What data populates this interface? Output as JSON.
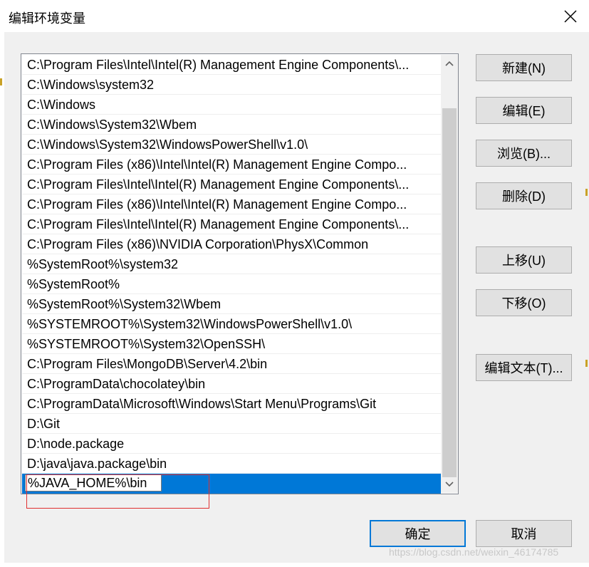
{
  "window": {
    "title": "编辑环境变量",
    "close_icon": "close-icon"
  },
  "list": {
    "items": [
      "C:\\Program Files\\Intel\\Intel(R) Management Engine Components\\...",
      "C:\\Windows\\system32",
      "C:\\Windows",
      "C:\\Windows\\System32\\Wbem",
      "C:\\Windows\\System32\\WindowsPowerShell\\v1.0\\",
      "C:\\Program Files (x86)\\Intel\\Intel(R) Management Engine Compo...",
      "C:\\Program Files\\Intel\\Intel(R) Management Engine Components\\...",
      "C:\\Program Files (x86)\\Intel\\Intel(R) Management Engine Compo...",
      "C:\\Program Files\\Intel\\Intel(R) Management Engine Components\\...",
      "C:\\Program Files (x86)\\NVIDIA Corporation\\PhysX\\Common",
      "%SystemRoot%\\system32",
      "%SystemRoot%",
      "%SystemRoot%\\System32\\Wbem",
      "%SYSTEMROOT%\\System32\\WindowsPowerShell\\v1.0\\",
      "%SYSTEMROOT%\\System32\\OpenSSH\\",
      "C:\\Program Files\\MongoDB\\Server\\4.2\\bin",
      "C:\\ProgramData\\chocolatey\\bin",
      "C:\\ProgramData\\Microsoft\\Windows\\Start Menu\\Programs\\Git",
      "D:\\Git",
      "D:\\node.package",
      "D:\\java\\java.package\\bin"
    ],
    "editing_value": "%JAVA_HOME%\\bin",
    "selection_color": "#0078d7",
    "scroll_up_icon": "chevron-up-icon",
    "scroll_down_icon": "chevron-down-icon"
  },
  "buttons": {
    "new": "新建(N)",
    "edit": "编辑(E)",
    "browse": "浏览(B)...",
    "delete": "删除(D)",
    "move_up": "上移(U)",
    "move_down": "下移(O)",
    "edit_text": "编辑文本(T)...",
    "ok": "确定",
    "cancel": "取消"
  },
  "watermark": "https://blog.csdn.net/weixin_46174785",
  "colors": {
    "accent": "#0078d7",
    "highlight_box": "#e03030"
  }
}
